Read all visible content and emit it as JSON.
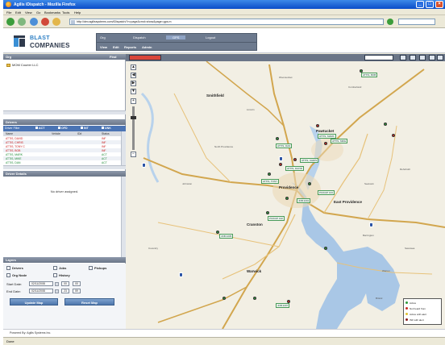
{
  "window": {
    "title": "Agilis iDispatch - Mozilla Firefox"
  },
  "menu": [
    "File",
    "Edit",
    "View",
    "Go",
    "Bookmarks",
    "Tools",
    "Help"
  ],
  "browser": {
    "url": "http://dev.agilissystems.com/iDispatch/?n=page&cmd=show&page=gps.m"
  },
  "brand": {
    "line1": "BLAST",
    "line2": "COMPANIES"
  },
  "header_nav": {
    "tabs": [
      "Org",
      "Dispatch",
      "GPS",
      "Logout"
    ],
    "selected": "GPS",
    "subtabs": [
      "View",
      "Edit",
      "Reports",
      "Admin"
    ]
  },
  "org_panel": {
    "title": "Org",
    "action": "Find",
    "items": [
      "MOM Courier LLC"
    ]
  },
  "drivers_panel": {
    "title": "Drivers",
    "filter_label": "Driver Filter",
    "filters": [
      "ACT",
      "OFD",
      "INT",
      "UNK"
    ],
    "columns": [
      "Name",
      "Vehicle",
      "ID#",
      "Status"
    ],
    "rows": [
      {
        "name": "ATTIS, DAVID",
        "status": "INF",
        "color": "red"
      },
      {
        "name": "ATTIS, CHRIS",
        "status": "INF",
        "color": "red"
      },
      {
        "name": "ATTIS, TONY C",
        "status": "INF",
        "color": "red"
      },
      {
        "name": "ATTIS, BOB",
        "status": "INF",
        "color": "red"
      },
      {
        "name": "ATTIS, MARK",
        "status": "ACT",
        "color": "green"
      },
      {
        "name": "ATTIS, MIKE",
        "status": "ACT",
        "color": "green"
      },
      {
        "name": "ATTIS, DAN",
        "status": "ACT",
        "color": "green"
      }
    ]
  },
  "driver_details": {
    "title": "Driver Details",
    "empty": "No driver assigned."
  },
  "layers": {
    "title": "Layers",
    "checkboxes": [
      "Drivers",
      "Jobs",
      "Pickups",
      "Org Node",
      "History"
    ],
    "start_label": "Start Date:",
    "end_label": "End Date:",
    "start_date": "02/11/2008",
    "end_date": "02/11/2008",
    "start_time": [
      "00",
      "00"
    ],
    "end_time": [
      "23",
      "59"
    ],
    "update_btn": "Update Map",
    "reset_btn": "Reset Map"
  },
  "map": {
    "cities": [
      "Providence",
      "East Providence",
      "Pawtucket",
      "Smithfield",
      "Warwick",
      "Cranston"
    ],
    "towns": [
      "Woonsocket",
      "Cumberland",
      "Lincoln",
      "North Providence",
      "Johnston",
      "Seekonk",
      "Rehoboth",
      "Coventry",
      "Barrington",
      "Bristol",
      "Warren",
      "Swansea"
    ],
    "labels": [
      "ATTIS, BOB",
      "ATTIS, MARK",
      "ATTIS, MIKE",
      "ATTIS, DAN",
      "ATTIS, CHRIS",
      "ATTIS, DAVID",
      "ATTIS, TONY",
      "PICKUP 102",
      "PICKUP 104",
      "JOB 2201",
      "JOB 2205",
      "JOB 2207"
    ],
    "legend": [
      "Active",
      "Not heard from",
      "Active with alert",
      "INF with alert"
    ]
  },
  "footer": {
    "powered": "Powered By: Agilis Systems Inc."
  },
  "status": {
    "text": "Done"
  }
}
